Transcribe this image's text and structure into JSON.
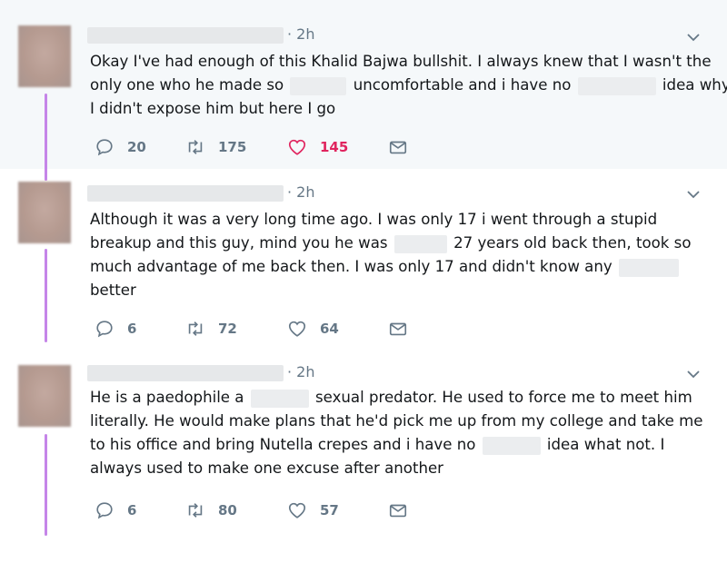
{
  "tweets": [
    {
      "time": "· 2h",
      "lines": [
        [
          {
            "t": "Okay I've had enough of this Khalid Bajwa bullshit. I always knew that I wasn't the"
          }
        ],
        [
          {
            "t": "only one who he made so "
          },
          {
            "blur": 62
          },
          {
            "t": " uncomfortable and i have no "
          },
          {
            "blur": 86
          },
          {
            "t": " idea why"
          }
        ],
        [
          {
            "t": "I didn't expose him but here I go"
          }
        ]
      ],
      "replies": "20",
      "retweets": "175",
      "likes": "145",
      "liked": true
    },
    {
      "time": "· 2h",
      "lines": [
        [
          {
            "t": "Although it was a very long time ago. I was only 17 i went through a stupid"
          }
        ],
        [
          {
            "t": "breakup and this guy, mind you he was "
          },
          {
            "blur": 58
          },
          {
            "t": " 27 years old back then, took so"
          }
        ],
        [
          {
            "t": "much advantage of me back then. I was only 17 and didn't know any "
          },
          {
            "blur": 66
          }
        ],
        [
          {
            "t": "better"
          }
        ]
      ],
      "replies": "6",
      "retweets": "72",
      "likes": "64",
      "liked": false
    },
    {
      "time": "· 2h",
      "lines": [
        [
          {
            "t": "He is a paedophile a "
          },
          {
            "blur": 64
          },
          {
            "t": " sexual predator. He used to force me to meet him"
          }
        ],
        [
          {
            "t": "literally. He would make plans that he'd pick me up from my college and take me"
          }
        ],
        [
          {
            "t": "to his office and bring Nutella crepes and i have no "
          },
          {
            "blur": 64
          },
          {
            "t": " idea what not. I"
          }
        ],
        [
          {
            "t": "always used to make one excuse after another"
          }
        ]
      ],
      "replies": "6",
      "retweets": "80",
      "likes": "57",
      "liked": false
    }
  ],
  "colors": {
    "accent_like": "#e0245e",
    "thread_line": "#c585e8",
    "meta_gray": "#657786"
  },
  "icons": [
    "reply-icon",
    "retweet-icon",
    "like-icon",
    "direct-message-icon",
    "chevron-down-icon"
  ]
}
